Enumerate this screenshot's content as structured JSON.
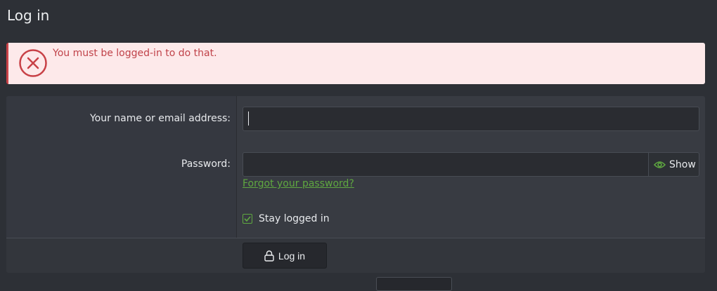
{
  "page": {
    "title": "Log in"
  },
  "error": {
    "message": "You must be logged-in to do that.",
    "icon": "x-circle-icon",
    "color": "#c0434a"
  },
  "form": {
    "login_label": "Your name or email address:",
    "login_value": "",
    "password_label": "Password:",
    "password_value": "",
    "show_label": "Show",
    "forgot_link": "Forgot your password?",
    "stay_logged_in_label": "Stay logged in",
    "stay_logged_in_checked": true,
    "submit_label": "Log in"
  },
  "colors": {
    "accent": "#5fa840",
    "background": "#2d3036"
  }
}
